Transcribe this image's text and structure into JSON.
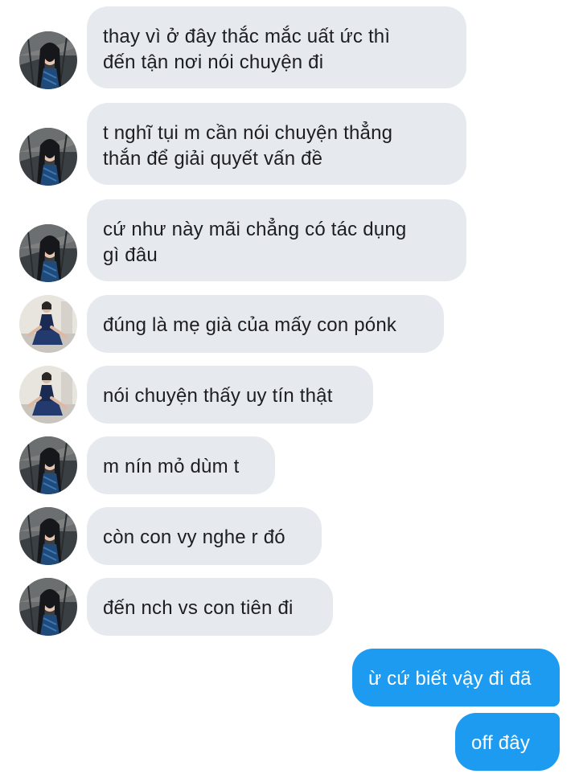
{
  "conversation": {
    "messages": [
      {
        "sender": "contact-a",
        "text": "thay vì ở đây thắc mắc uất ức thì\nđến tận nơi nói chuyện đi"
      },
      {
        "sender": "contact-a",
        "text": "t nghĩ tụi m cần nói chuyện thẳng\nthắn để giải quyết vấn đề"
      },
      {
        "sender": "contact-a",
        "text": "cứ như này mãi chẳng có tác dụng\ngì đâu"
      },
      {
        "sender": "contact-b",
        "text": "đúng là mẹ già của mấy con pónk"
      },
      {
        "sender": "contact-b",
        "text": "nói chuyện thấy uy tín thật"
      },
      {
        "sender": "contact-a",
        "text": "m nín mỏ dùm t"
      },
      {
        "sender": "contact-a",
        "text": "còn con vy nghe r đó"
      },
      {
        "sender": "contact-a",
        "text": "đến nch vs con tiên đi"
      },
      {
        "sender": "me",
        "text": "ừ cứ biết vậy đi đã"
      },
      {
        "sender": "me",
        "text": "off đây"
      }
    ]
  },
  "colors": {
    "incoming_bubble": "#e6eaee",
    "outgoing_bubble": "#1d9bf0",
    "incoming_text": "#1c1e21",
    "outgoing_text": "#ffffff"
  },
  "icons": {
    "avatar_a": "profile-photo-dark-hair-avatar",
    "avatar_b": "profile-photo-seated-woman-avatar"
  }
}
